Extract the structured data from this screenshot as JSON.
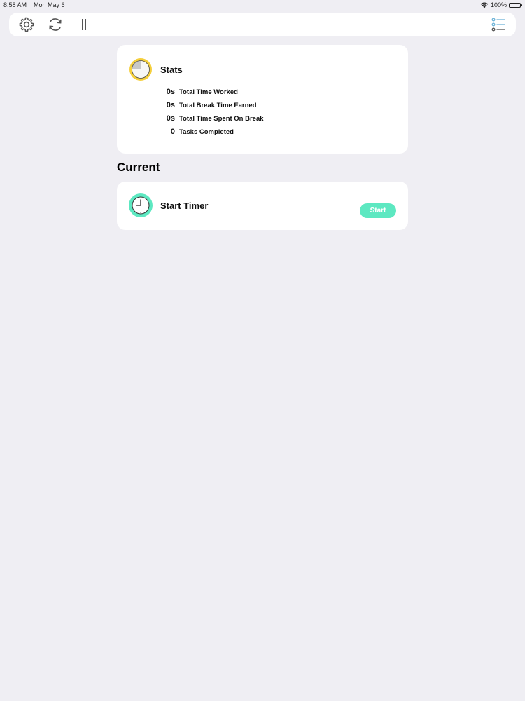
{
  "status_bar": {
    "time": "8:58 AM",
    "date": "Mon May 6",
    "battery": "100%"
  },
  "toolbar": {
    "icons": [
      "gear-icon",
      "refresh-icon",
      "pause-icon",
      "list-icon"
    ]
  },
  "stats": {
    "title": "Stats",
    "rows": [
      {
        "value": "0s",
        "label": "Total Time Worked"
      },
      {
        "value": "0s",
        "label": "Total Break Time Earned"
      },
      {
        "value": "0s",
        "label": "Total Time Spent On Break"
      },
      {
        "value": "0",
        "label": "Tasks Completed"
      }
    ]
  },
  "current": {
    "heading": "Current",
    "timer_title": "Start Timer",
    "start_label": "Start"
  },
  "colors": {
    "background": "#efeef3",
    "accent_green": "#5de8c1",
    "stats_yellow": "#f5cf3c",
    "list_icon_blue": "#6fb4d8"
  }
}
